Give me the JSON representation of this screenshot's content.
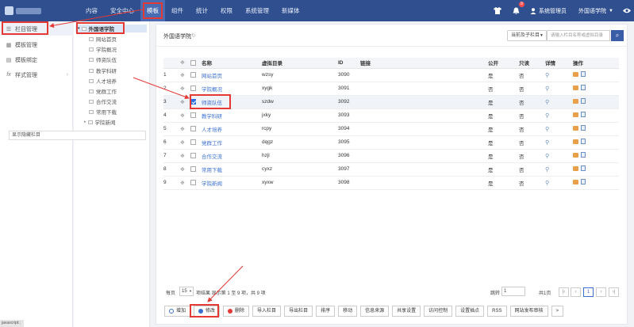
{
  "nav": [
    "内容",
    "安全中心",
    "模板",
    "组件",
    "统计",
    "权限",
    "系统管理",
    "新媒体"
  ],
  "header_right": {
    "notif_count": "9",
    "user": "系统管理员",
    "site": "外国语学院"
  },
  "sidebar1": [
    {
      "label": "栏目管理",
      "icon": "menu-icon"
    },
    {
      "label": "模板管理",
      "icon": "template-icon"
    },
    {
      "label": "模板绑定",
      "icon": "bind-icon"
    },
    {
      "label": "样式管理",
      "icon": "fx-icon"
    }
  ],
  "tree": {
    "root": "外国语学院",
    "children": [
      "网站首页",
      "学院概况",
      "师资队伍",
      "教学科研",
      "人才培养",
      "党群工作",
      "合作交流",
      "常用下载",
      "学院新闻"
    ],
    "show_hidden": "显示隐藏栏目"
  },
  "main": {
    "title": "外国语学院",
    "select": "当前及子栏目",
    "search_placeholder": "请输入栏目名称或虚拟目录"
  },
  "table": {
    "headers": [
      "名称",
      "虚拟目录",
      "ID",
      "链接",
      "公开",
      "只读",
      "详情",
      "操作"
    ],
    "rows": [
      {
        "no": "1",
        "name": "网站首页",
        "dir": "wzsy",
        "id": "3090",
        "pub": "是",
        "ro": "否"
      },
      {
        "no": "2",
        "name": "学院概况",
        "dir": "xygk",
        "id": "3091",
        "pub": "否",
        "ro": "否"
      },
      {
        "no": "3",
        "name": "师资队伍",
        "dir": "szdw",
        "id": "3092",
        "pub": "是",
        "ro": "否"
      },
      {
        "no": "4",
        "name": "教学科研",
        "dir": "jxky",
        "id": "3093",
        "pub": "是",
        "ro": "否"
      },
      {
        "no": "5",
        "name": "人才培养",
        "dir": "rcpy",
        "id": "3094",
        "pub": "是",
        "ro": "否"
      },
      {
        "no": "6",
        "name": "党群工作",
        "dir": "dqgz",
        "id": "3095",
        "pub": "是",
        "ro": "否"
      },
      {
        "no": "7",
        "name": "合作交流",
        "dir": "hzjl",
        "id": "3096",
        "pub": "是",
        "ro": "否"
      },
      {
        "no": "8",
        "name": "常用下载",
        "dir": "cyxz",
        "id": "3097",
        "pub": "是",
        "ro": "否"
      },
      {
        "no": "9",
        "name": "学院新闻",
        "dir": "xyxw",
        "id": "3098",
        "pub": "是",
        "ro": "否"
      }
    ]
  },
  "pager": {
    "per_page_label": "每页",
    "per_page": "15",
    "info": "项结果 显示第 1 至 9 项，共 9 项",
    "jump_label": "跳转",
    "jump_val": "1",
    "total_pages": "共1页",
    "current": "1"
  },
  "buttons": [
    "增加",
    "修改",
    "删除",
    "导入栏目",
    "导出栏目",
    "排序",
    "移动",
    "信息来源",
    "共享设置",
    "访问控制",
    "设置插点",
    "RSS",
    "网站发布审核",
    ">"
  ],
  "status_text": "javascript:;"
}
